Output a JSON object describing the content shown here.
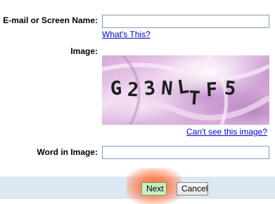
{
  "form": {
    "email_label": "E-mail or Screen Name:",
    "email_value": "",
    "whats_this_link": "What's This?",
    "image_label": "Image:",
    "captcha_text": "G23NLTF5",
    "cant_see_link": "Can't see this image?",
    "word_label": "Word in Image:",
    "word_value": ""
  },
  "buttons": {
    "next_label": "Next",
    "cancel_label": "Cancel"
  },
  "colors": {
    "link": "#0000cc",
    "button_bar": "#dce8f4",
    "highlight": "#ff6e3c",
    "next_button": "#c8efbf"
  }
}
